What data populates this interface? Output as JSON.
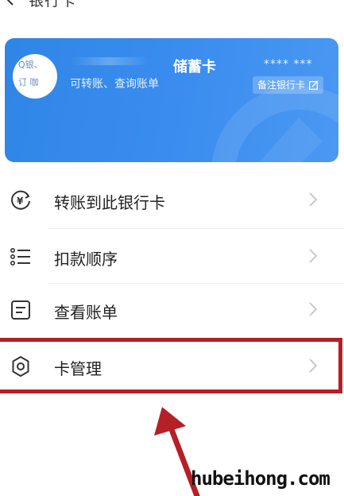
{
  "nav": {
    "title": "银行卡"
  },
  "card": {
    "logo_text_top": "Q银、",
    "logo_text_bottom": "订 咖",
    "type_label": "储蓄卡",
    "subtitle": "可转账、查询账单",
    "masked_number": "**** ***",
    "note_button": "备注银行卡",
    "colors": {
      "gradient_start": "#2f86e6",
      "gradient_end": "#4a98f2"
    }
  },
  "menu": {
    "items": [
      {
        "label": "转账到此银行卡",
        "icon": "yuan-transfer-icon"
      },
      {
        "label": "扣款顺序",
        "icon": "list-icon"
      },
      {
        "label": "查看账单",
        "icon": "bill-icon"
      },
      {
        "label": "卡管理",
        "icon": "gear-icon"
      }
    ]
  },
  "annotation": {
    "highlight_color": "#b52026"
  },
  "watermark": "hubeihong.com"
}
